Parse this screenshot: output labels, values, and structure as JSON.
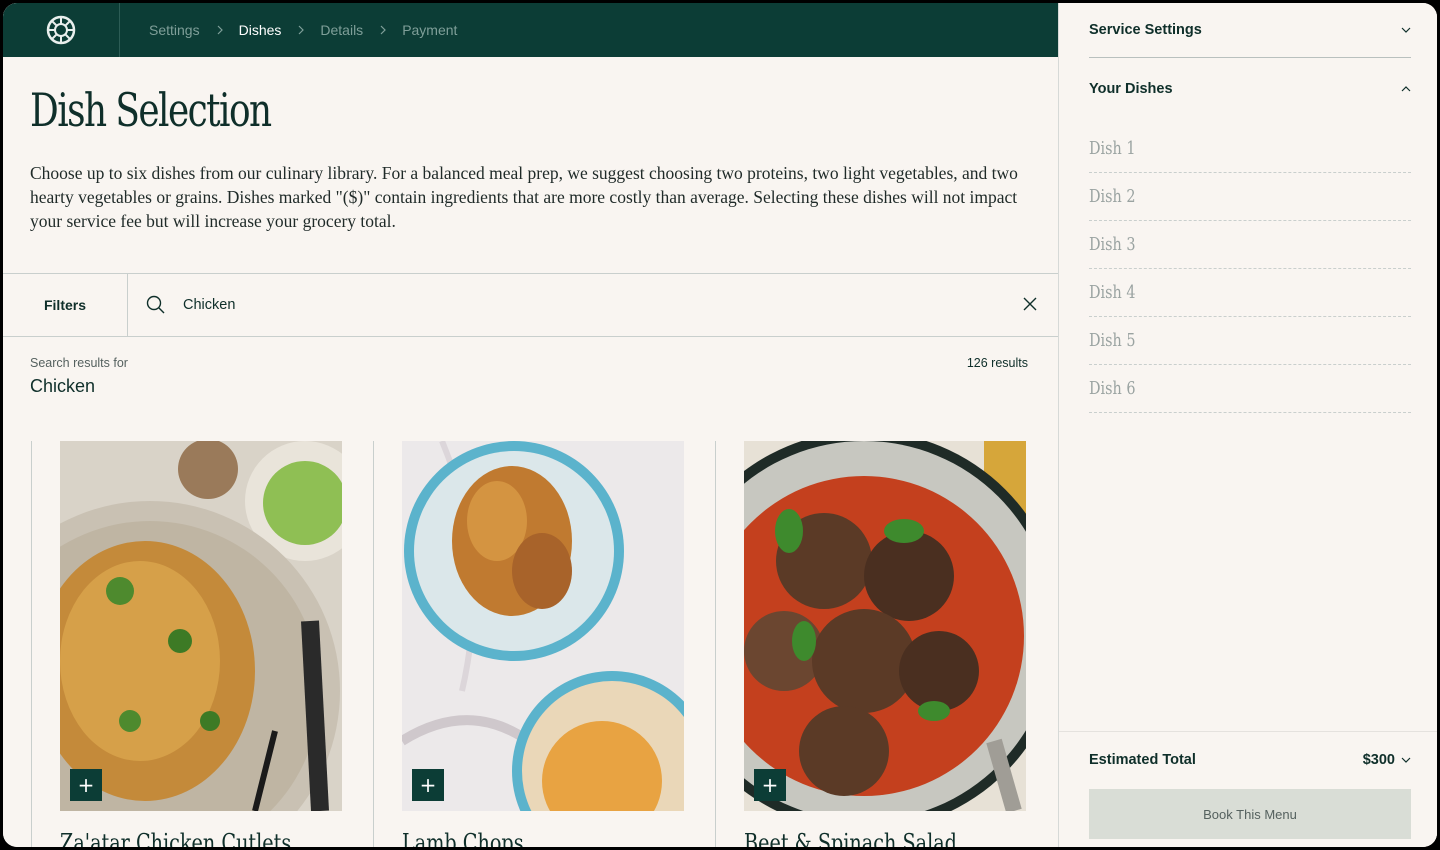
{
  "breadcrumb": {
    "items": [
      {
        "label": "Settings",
        "active": false
      },
      {
        "label": "Dishes",
        "active": true
      },
      {
        "label": "Details",
        "active": false
      },
      {
        "label": "Payment",
        "active": false
      }
    ]
  },
  "page": {
    "title": "Dish Selection",
    "intro": "Choose up to six dishes from our culinary library. For a balanced meal prep, we suggest choosing two proteins, two light vegetables, and two hearty vegetables or grains. Dishes marked \"($)\" contain ingredients that are more costly than average. Selecting these dishes will not impact your service fee but will increase your grocery total."
  },
  "filters": {
    "filters_label": "Filters",
    "search_value": "Chicken"
  },
  "results": {
    "label": "Search results for",
    "term": "Chicken",
    "count": "126 results"
  },
  "dishes": [
    {
      "title": "Za'atar Chicken Cutlets",
      "add": "+"
    },
    {
      "title": "Lamb Chops",
      "add": "+"
    },
    {
      "title": "Beet & Spinach Salad",
      "add": "+"
    }
  ],
  "sidebar": {
    "service_settings": "Service Settings",
    "your_dishes": "Your Dishes",
    "slots": [
      "Dish 1",
      "Dish 2",
      "Dish 3",
      "Dish 4",
      "Dish 5",
      "Dish 6"
    ],
    "estimated_total_label": "Estimated Total",
    "estimated_total_value": "$300",
    "book_label": "Book This Menu"
  },
  "colors": {
    "brand_dark_green": "#0c3d36",
    "background": "#f9f5f1",
    "book_button": "#d9ddd6"
  },
  "icons": [
    "logo-icon",
    "chevron-right-icon",
    "search-icon",
    "close-icon",
    "chevron-down-icon",
    "chevron-up-icon",
    "plus-icon"
  ]
}
